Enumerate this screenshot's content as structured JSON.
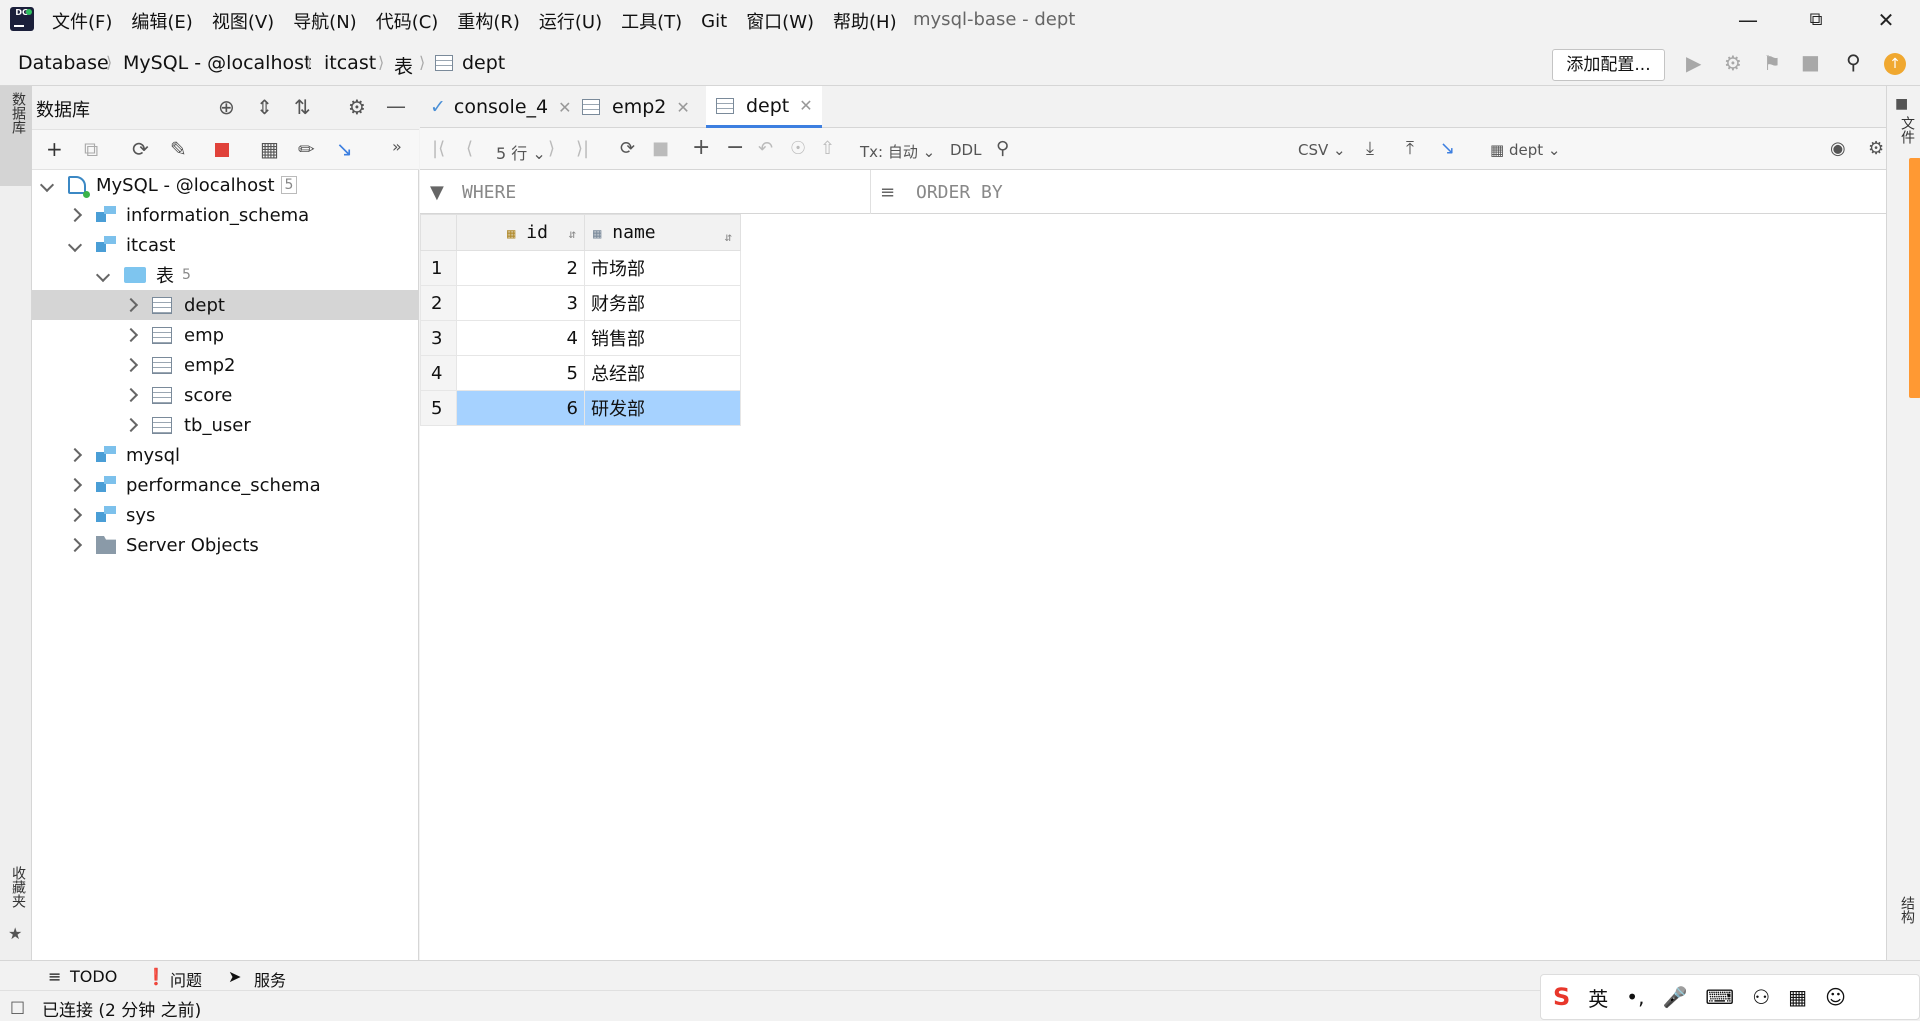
{
  "app": {
    "window_title": "mysql-base - dept",
    "menu": [
      "文件(F)",
      "编辑(E)",
      "视图(V)",
      "导航(N)",
      "代码(C)",
      "重构(R)",
      "运行(U)",
      "工具(T)",
      "Git",
      "窗口(W)",
      "帮助(H)"
    ]
  },
  "breadcrumb": [
    "Database",
    "MySQL - @localhost",
    "itcast",
    "表",
    "dept"
  ],
  "toolbar": {
    "add_config": "添加配置..."
  },
  "left_strip": {
    "db_tab": "数据库",
    "fav_tab": "收藏夹"
  },
  "db_panel": {
    "title": "数据库",
    "tree": [
      {
        "label": "MySQL - @localhost",
        "count": "5"
      },
      {
        "label": "information_schema"
      },
      {
        "label": "itcast"
      },
      {
        "label": "表",
        "count": "5"
      },
      {
        "label": "dept"
      },
      {
        "label": "emp"
      },
      {
        "label": "emp2"
      },
      {
        "label": "score"
      },
      {
        "label": "tb_user"
      },
      {
        "label": "mysql"
      },
      {
        "label": "performance_schema"
      },
      {
        "label": "sys"
      },
      {
        "label": "Server Objects"
      }
    ]
  },
  "editor": {
    "tabs": [
      "console_4",
      "emp2",
      "dept"
    ],
    "rows_label": "5 行",
    "tx_label": "Tx: 自动",
    "ddl_label": "DDL",
    "csv_label": "CSV",
    "table_selector": "dept",
    "where": "WHERE",
    "order_by": "ORDER BY",
    "columns": [
      "id",
      "name"
    ],
    "rows": [
      {
        "n": "1",
        "id": "2",
        "name": "市场部"
      },
      {
        "n": "2",
        "id": "3",
        "name": "财务部"
      },
      {
        "n": "3",
        "id": "4",
        "name": "销售部"
      },
      {
        "n": "4",
        "id": "5",
        "name": "总经部"
      },
      {
        "n": "5",
        "id": "6",
        "name": "研发部"
      }
    ]
  },
  "right_strip": {
    "file_tab": "文件",
    "structure_tab": "结构"
  },
  "bottom": {
    "todo": "TODO",
    "problems": "问题",
    "services": "服务"
  },
  "status": {
    "text": "已连接 (2 分钟 之前)"
  },
  "ime": {
    "lang": "英"
  }
}
